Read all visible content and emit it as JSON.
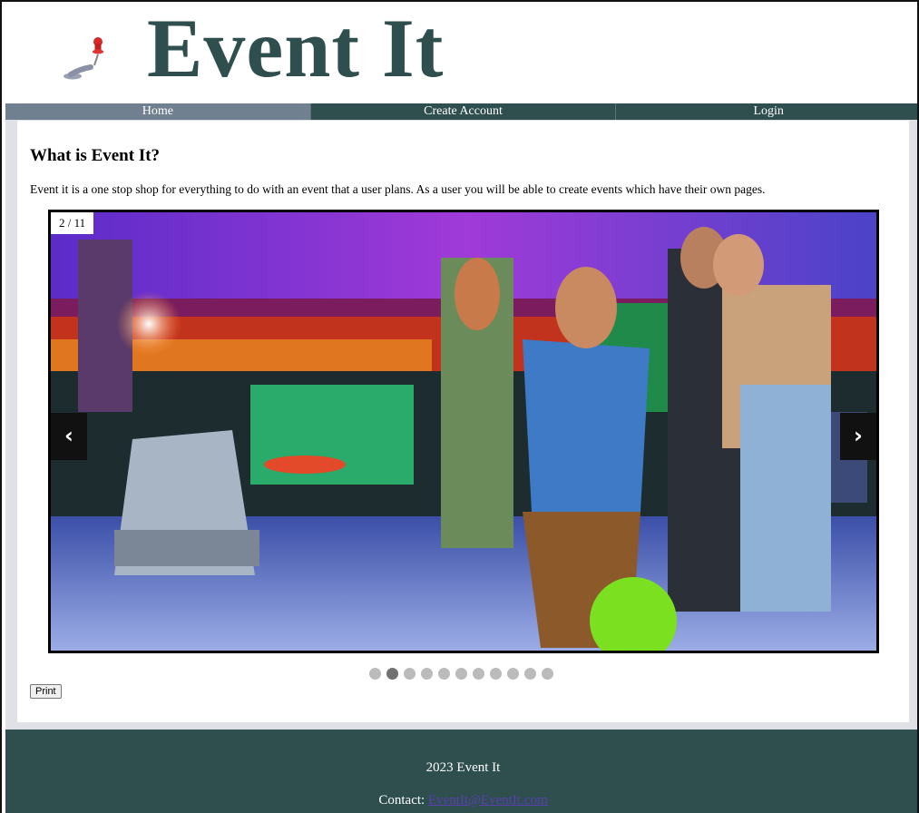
{
  "site": {
    "title": "Event It",
    "logo_icon": "pushpin-icon"
  },
  "nav": {
    "items": [
      {
        "label": "Home",
        "active": true
      },
      {
        "label": "Create Account",
        "active": false
      },
      {
        "label": "Login",
        "active": false
      }
    ]
  },
  "main": {
    "heading": "What is Event It?",
    "intro": "Event it is a one stop shop for everything to do with an event that a user plans. As a user you will be able to create events which have their own pages.",
    "slideshow": {
      "counter": "2 / 11",
      "current": 2,
      "total": 11,
      "prev_label": "‹",
      "next_label": "›"
    },
    "print_label": "Print"
  },
  "footer": {
    "copyright": "2023 Event It",
    "contact_label": "Contact: ",
    "contact_email": "EventIt@EventIt.com"
  },
  "colors": {
    "brand": "#2f4f4f",
    "nav_active": "#708090",
    "dot_inactive": "#bbbbbb",
    "dot_active": "#717171"
  }
}
